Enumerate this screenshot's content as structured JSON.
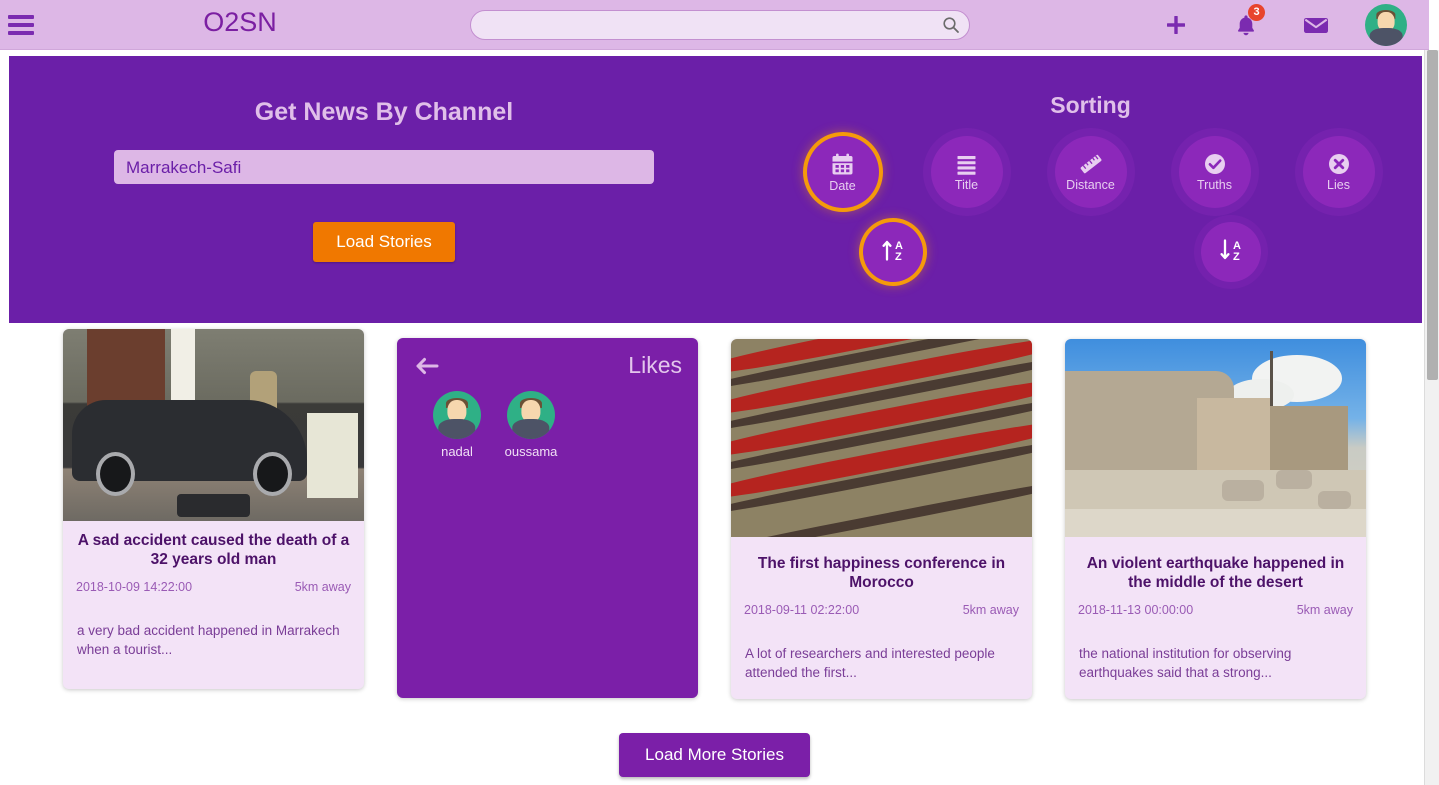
{
  "header": {
    "menu_icon": "hamburger-icon",
    "brand": "O2SN",
    "search": {
      "value": "",
      "placeholder": "",
      "icon": "search-icon"
    },
    "actions": [
      {
        "name": "add",
        "icon": "plus-icon",
        "badge": null
      },
      {
        "name": "notifications",
        "icon": "bell-icon",
        "badge": "3"
      },
      {
        "name": "messages",
        "icon": "envelope-icon",
        "badge": null
      }
    ],
    "avatar_label": "user-avatar",
    "bg_color": "#ddb7e6",
    "brand_color": "#7b1fa2",
    "badge_color": "#e8442c"
  },
  "filters": {
    "channel": {
      "title": "Get News By Channel",
      "selected": "Marrakech-Safi",
      "options": [
        "Marrakech-Safi"
      ],
      "load_button": "Load Stories",
      "load_button_color": "#f07800"
    },
    "sorting": {
      "title": "Sorting",
      "options": [
        {
          "label": "Date",
          "icon": "calendar-icon",
          "selected": true
        },
        {
          "label": "Title",
          "icon": "list-lines-icon",
          "selected": false
        },
        {
          "label": "Distance",
          "icon": "ruler-icon",
          "selected": false
        },
        {
          "label": "Truths",
          "icon": "check-circle-icon",
          "selected": false
        },
        {
          "label": "Lies",
          "icon": "x-circle-icon",
          "selected": false
        }
      ],
      "directions": [
        {
          "label": "Ascending",
          "icon": "sort-amount-up-az-icon",
          "selected": true
        },
        {
          "label": "Descending",
          "icon": "sort-amount-down-az-icon",
          "selected": false
        }
      ],
      "selected_color": "#f59a0b"
    },
    "panel_color": "#6b1fa8"
  },
  "stories": [
    {
      "type": "story",
      "photo": "car-crash-photo",
      "title": "A sad accident caused the death of a 32 years old man",
      "date": "2018-10-09 14:22:00",
      "distance": "5km away",
      "excerpt": "a very bad accident happened in Marrakech when a tourist..."
    },
    {
      "type": "likes",
      "back_icon": "arrow-left-icon",
      "title": "Likes",
      "likers": [
        {
          "name": "nadal"
        },
        {
          "name": "oussama"
        }
      ]
    },
    {
      "type": "story",
      "photo": "conference-auditorium-photo",
      "title": "The first happiness conference in Morocco",
      "date": "2018-09-11 02:22:00",
      "distance": "5km away",
      "excerpt": "A lot of researchers and interested people attended the first..."
    },
    {
      "type": "story",
      "photo": "earthquake-rubble-photo",
      "title": "An violent earthquake happened in the middle of the desert",
      "date": "2018-11-13 00:00:00",
      "distance": "5km away",
      "excerpt": "the national institution for observing earthquakes said that a strong..."
    }
  ],
  "footer": {
    "load_more": "Load More Stories",
    "load_more_color": "#7b1fa8"
  }
}
